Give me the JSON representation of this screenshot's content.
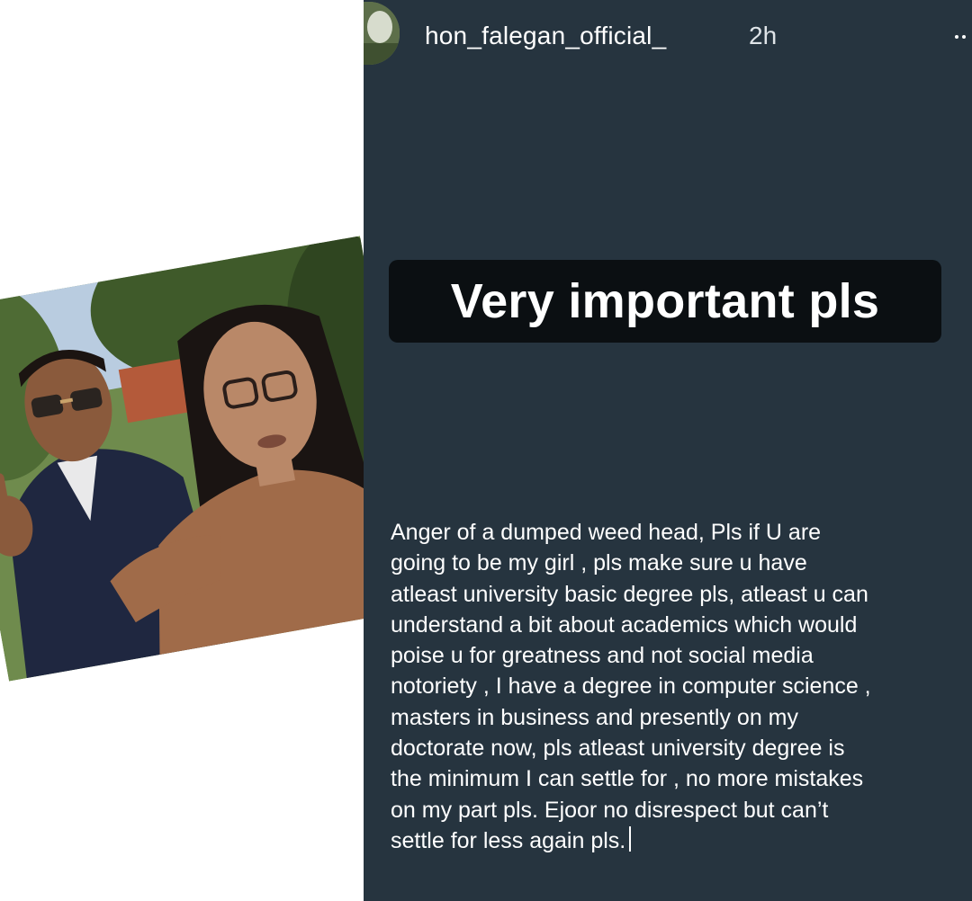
{
  "left_photo": {
    "alt": "photo"
  },
  "story": {
    "username": "hon_falegan_official_",
    "time": "2h",
    "more_icon": "more-dots-icon",
    "headline": "Very important pls",
    "caption_lines": [
      "Anger of a dumped weed head, Pls if U are",
      "going to be my girl , pls make sure u have",
      "atleast university basic degree pls, atleast u can",
      "understand a bit about academics which would",
      "poise u for greatness and  not social media",
      "notoriety , I have a degree in computer science ,",
      "masters in business and presently on my",
      "doctorate now, pls atleast university degree is",
      "the minimum I can settle for , no more mistakes",
      "on my part pls.  Ejoor no disrespect but can’t",
      "settle for less again pls."
    ],
    "colors": {
      "background": "#26343f",
      "headline_box": "#0b0f12",
      "text": "#ffffff"
    }
  }
}
